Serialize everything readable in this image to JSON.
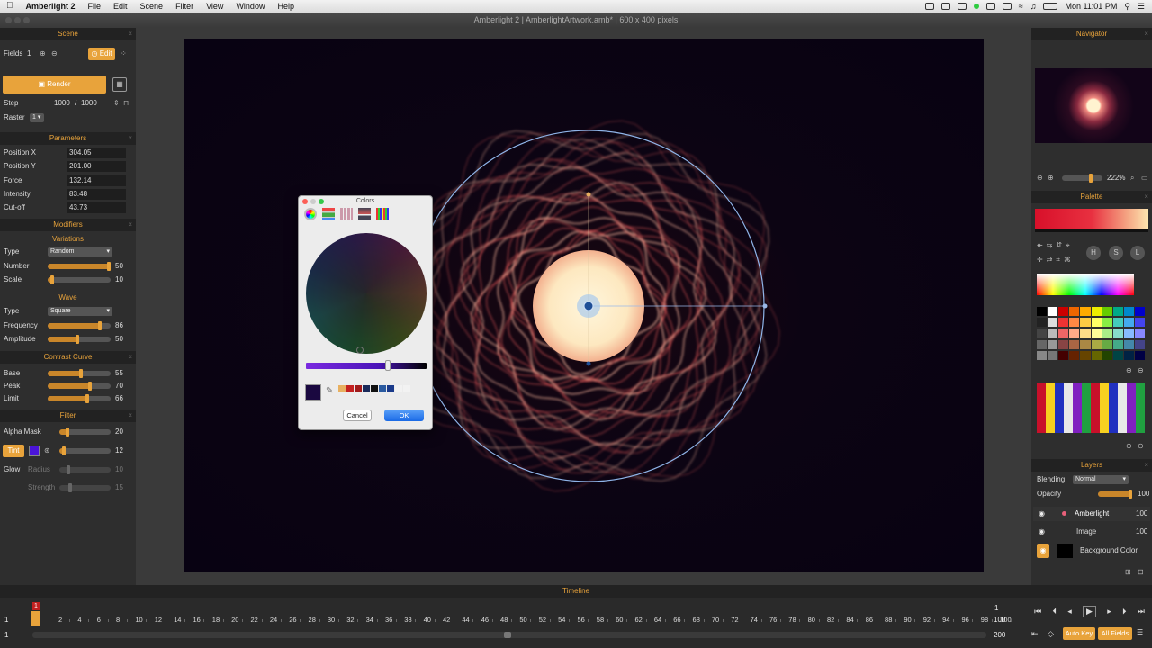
{
  "menubar": {
    "app": "Amberlight 2",
    "items": [
      "File",
      "Edit",
      "Scene",
      "Filter",
      "View",
      "Window",
      "Help"
    ],
    "clock": "Mon 11:01 PM"
  },
  "window": {
    "title": "Amberlight 2 | AmberlightArtwork.amb* | 600 x 400 pixels"
  },
  "scene": {
    "header": "Scene",
    "fields_label": "Fields",
    "fields_value": "1",
    "edit_label": "Edit",
    "render_label": "Render",
    "step_label": "Step",
    "step_value": "1000",
    "step_sep": "/",
    "step_total": "1000",
    "raster_label": "Raster",
    "raster_value": "1"
  },
  "parameters": {
    "header": "Parameters",
    "items": [
      {
        "label": "Position X",
        "value": "304.05"
      },
      {
        "label": "Position Y",
        "value": "201.00"
      },
      {
        "label": "Force",
        "value": "132.14"
      },
      {
        "label": "Intensity",
        "value": "83.48"
      },
      {
        "label": "Cut-off",
        "value": "43.73"
      }
    ]
  },
  "modifiers": {
    "header": "Modifiers",
    "variations": {
      "header": "Variations",
      "type_label": "Type",
      "type_value": "Random",
      "number_label": "Number",
      "number_value": "50",
      "number_level": 1.0,
      "scale_label": "Scale",
      "scale_value": "10",
      "scale_level": 0.1
    },
    "wave": {
      "header": "Wave",
      "type_label": "Type",
      "type_value": "Square",
      "frequency_label": "Frequency",
      "frequency_value": "86",
      "frequency_level": 0.86,
      "amplitude_label": "Amplitude",
      "amplitude_value": "50",
      "amplitude_level": 0.5
    }
  },
  "contrast": {
    "header": "Contrast Curve",
    "base_label": "Base",
    "base_value": "55",
    "base_level": 0.55,
    "peak_label": "Peak",
    "peak_value": "70",
    "peak_level": 0.7,
    "limit_label": "Limit",
    "limit_value": "66",
    "limit_level": 0.66
  },
  "filter": {
    "header": "Filter",
    "alpha_label": "Alpha Mask",
    "alpha_value": "20",
    "alpha_level": 0.2,
    "tint_label": "Tint",
    "tint_value": "12",
    "tint_level": 0.12,
    "tint_color": "#4a14d8",
    "glow_label": "Glow",
    "radius_label": "Radius",
    "radius_value": "10",
    "strength_label": "Strength",
    "strength_value": "15"
  },
  "colors_dialog": {
    "title": "Colors",
    "cancel_label": "Cancel",
    "ok_label": "OK",
    "selected_color": "#1a0840"
  },
  "navigator": {
    "header": "Navigator",
    "zoom": "222%"
  },
  "palette": {
    "header": "Palette",
    "h": "H",
    "s": "S",
    "l": "L"
  },
  "layers": {
    "header": "Layers",
    "blending_label": "Blending",
    "blending_value": "Normal",
    "opacity_label": "Opacity",
    "opacity_value": "100",
    "items": [
      {
        "name": "Amberlight",
        "value": "100"
      },
      {
        "name": "Image",
        "value": "100"
      },
      {
        "name": "Background Color",
        "value": ""
      }
    ]
  },
  "timeline": {
    "header": "Timeline",
    "ticks": [
      "2",
      "4",
      "6",
      "8",
      "10",
      "12",
      "14",
      "16",
      "18",
      "20",
      "22",
      "24",
      "26",
      "28",
      "30",
      "32",
      "34",
      "36",
      "38",
      "40",
      "42",
      "44",
      "46",
      "48",
      "50",
      "52",
      "54",
      "56",
      "58",
      "60",
      "62",
      "64",
      "66",
      "68",
      "70",
      "72",
      "74",
      "76",
      "78",
      "80",
      "82",
      "84",
      "86",
      "88",
      "90",
      "92",
      "94",
      "96",
      "98",
      "100"
    ],
    "start": "1",
    "current": "1",
    "end_top": "1",
    "end_value": "100",
    "row2_start": "1",
    "row2_end": "200",
    "auto_key_label": "Auto Key",
    "all_fields_label": "All Fields"
  }
}
